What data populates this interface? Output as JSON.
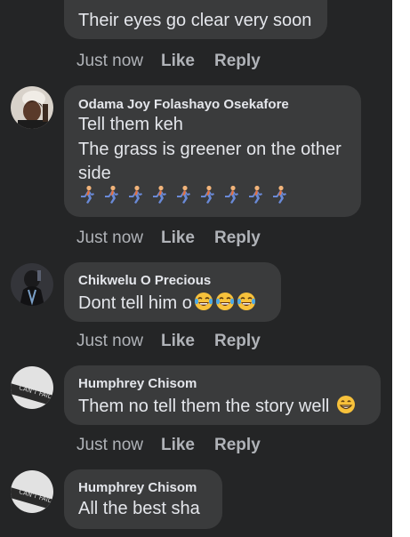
{
  "comments": [
    {
      "lines": [
        "Their eyes go clear very soon"
      ],
      "time": "Just now",
      "like": "Like",
      "reply": "Reply"
    },
    {
      "author": "Odama Joy Folashayo Osekafore",
      "lines": [
        "Tell them keh",
        "The grass is greener on the other",
        "side"
      ],
      "emoji": [
        "person-running-emoji",
        "person-running-emoji",
        "person-running-emoji",
        "person-running-emoji",
        "person-running-emoji",
        "person-running-emoji",
        "person-running-emoji",
        "person-running-emoji",
        "person-running-emoji"
      ],
      "time": "Just now",
      "like": "Like",
      "reply": "Reply"
    },
    {
      "author": "Chikwelu O Precious",
      "lines": [
        "Dont tell him o"
      ],
      "emoji": [
        "laughing-tears-emoji",
        "laughing-tears-emoji",
        "laughing-tears-emoji"
      ],
      "time": "Just now",
      "like": "Like",
      "reply": "Reply"
    },
    {
      "author": "Humphrey Chisom",
      "lines": [
        "Them no tell them the story well"
      ],
      "emoji": [
        "grinning-emoji"
      ],
      "time": "Just now",
      "like": "Like",
      "reply": "Reply"
    },
    {
      "author": "Humphrey Chisom",
      "lines": [
        "All the best sha"
      ]
    }
  ],
  "colors": {
    "background": "#242526",
    "bubble": "#3a3b3c",
    "text": "#e4e6eb",
    "meta": "#b0b3b8"
  }
}
